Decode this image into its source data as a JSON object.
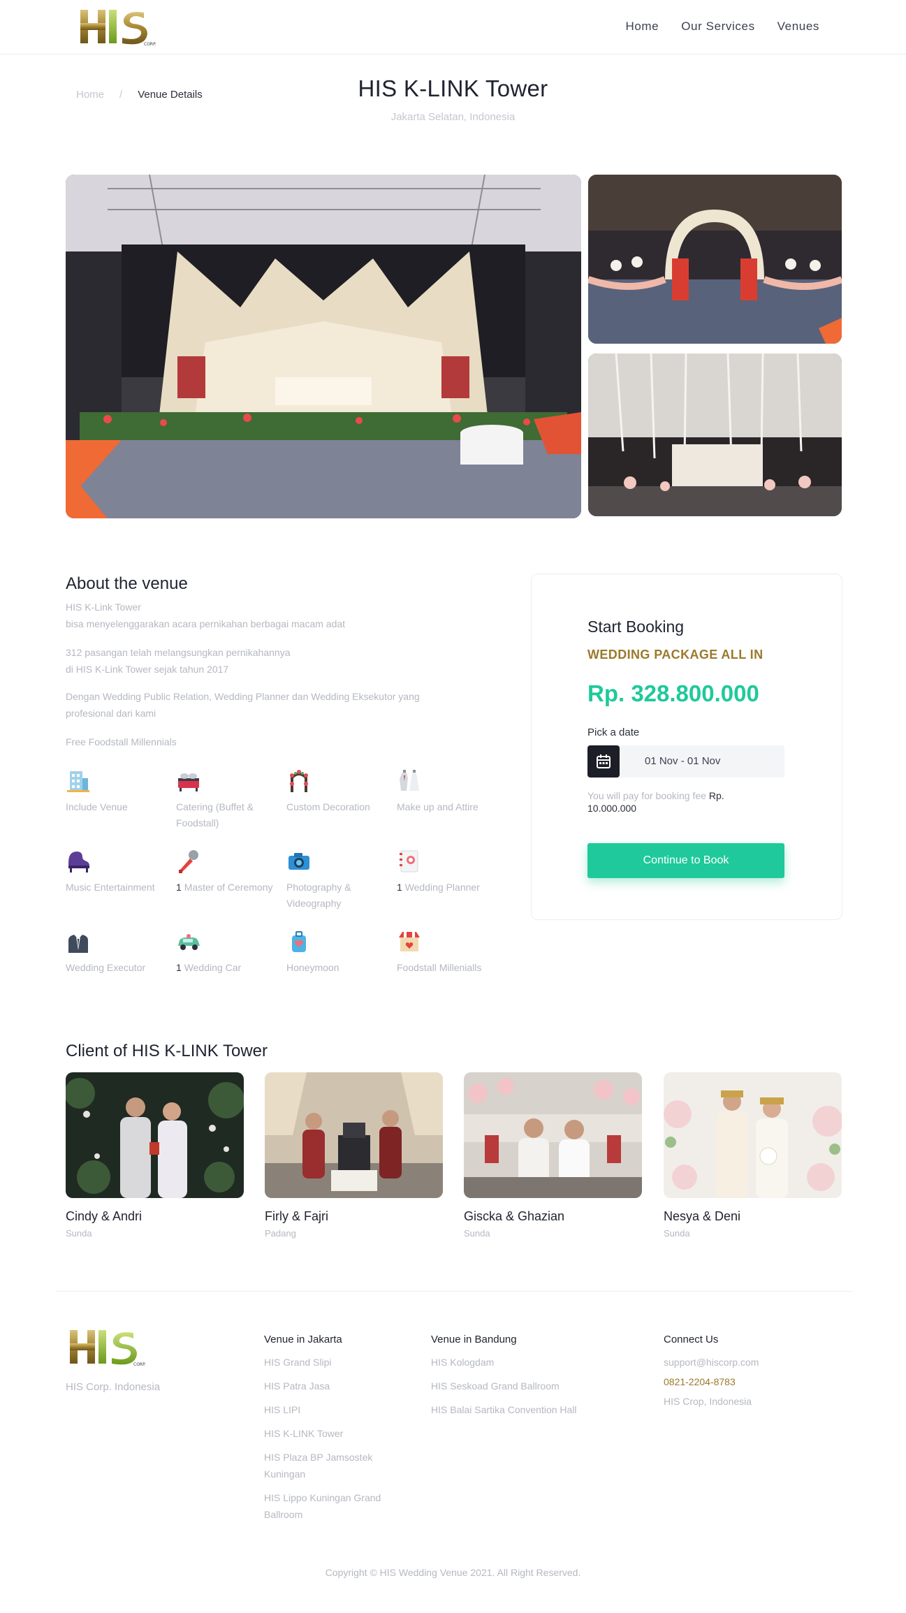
{
  "nav": {
    "logo_text": "HIS CORP.",
    "links": [
      "Home",
      "Our Services",
      "Venues"
    ]
  },
  "breadcrumb": {
    "home": "Home",
    "separator": "/",
    "current": "Venue Details"
  },
  "venue": {
    "title": "HIS K-LINK Tower",
    "location": "Jakarta Selatan, Indonesia"
  },
  "about": {
    "title": "About the venue",
    "p1_line1": "HIS K-Link Tower",
    "p1_line2": "bisa menyelenggarakan acara pernikahan berbagai macam adat",
    "p2_line1": "312 pasangan telah melangsungkan pernikahannya",
    "p2_line2": "di HIS K-Link Tower sejak tahun 2017",
    "p3_line1": "Dengan Wedding Public Relation, Wedding Planner dan Wedding Eksekutor yang",
    "p3_line2": "profesional dari kami",
    "p4": "Free Foodstall Millennials"
  },
  "amenities": [
    {
      "icon": "building-icon",
      "count": "",
      "label": "Include Venue"
    },
    {
      "icon": "catering-icon",
      "count": "",
      "label": "Catering (Buffet & Foodstall)"
    },
    {
      "icon": "decoration-icon",
      "count": "",
      "label": "Custom Decoration"
    },
    {
      "icon": "attire-icon",
      "count": "",
      "label": "Make up and Attire"
    },
    {
      "icon": "piano-icon",
      "count": "",
      "label": "Music Entertainment"
    },
    {
      "icon": "microphone-icon",
      "count": "1",
      "label": "Master of Ceremony"
    },
    {
      "icon": "camera-icon",
      "count": "",
      "label": "Photography & Videography"
    },
    {
      "icon": "planner-icon",
      "count": "1",
      "label": "Wedding Planner"
    },
    {
      "icon": "suit-icon",
      "count": "",
      "label": "Wedding Executor"
    },
    {
      "icon": "car-icon",
      "count": "1",
      "label": "Wedding Car"
    },
    {
      "icon": "suitcase-icon",
      "count": "",
      "label": "Honeymoon"
    },
    {
      "icon": "foodstall-icon",
      "count": "",
      "label": "Foodstall Millenialls"
    }
  ],
  "booking": {
    "title": "Start Booking",
    "package": "WEDDING PACKAGE ALL IN",
    "price": "Rp. 328.800.000",
    "pick_label": "Pick a date",
    "date_value": "01 Nov - 01 Nov",
    "fee_text": "You will pay for booking fee",
    "fee_amount": "Rp. 10.000.000",
    "button_label": "Continue to Book"
  },
  "clients": {
    "title": "Client of HIS K-LINK Tower",
    "items": [
      {
        "name": "Cindy & Andri",
        "origin": "Sunda"
      },
      {
        "name": "Firly & Fajri",
        "origin": "Padang"
      },
      {
        "name": "Giscka & Ghazian",
        "origin": "Sunda"
      },
      {
        "name": "Nesya & Deni",
        "origin": "Sunda"
      }
    ]
  },
  "footer": {
    "company": "HIS Corp. Indonesia",
    "jakarta": {
      "heading": "Venue in Jakarta",
      "links": [
        "HIS Grand Slipi",
        "HIS Patra Jasa",
        "HIS LIPI",
        "HIS K-LINK Tower",
        "HIS Plaza BP Jamsostek Kuningan",
        "HIS Lippo Kuningan Grand Ballroom"
      ]
    },
    "bandung": {
      "heading": "Venue in Bandung",
      "links": [
        "HIS Kologdam",
        "HIS Seskoad Grand Ballroom",
        "HIS Balai Sartika Convention Hall"
      ]
    },
    "connect": {
      "heading": "Connect Us",
      "email": "support@hiscorp.com",
      "phone": "0821-2204-8783",
      "address": "HIS Crop, Indonesia"
    },
    "copyright": "Copyright © HIS Wedding Venue 2021. All Right Reserved."
  },
  "colors": {
    "accent_green": "#1fc99b",
    "gold": "#9a7a2c",
    "muted_text": "#b4b8c0"
  }
}
